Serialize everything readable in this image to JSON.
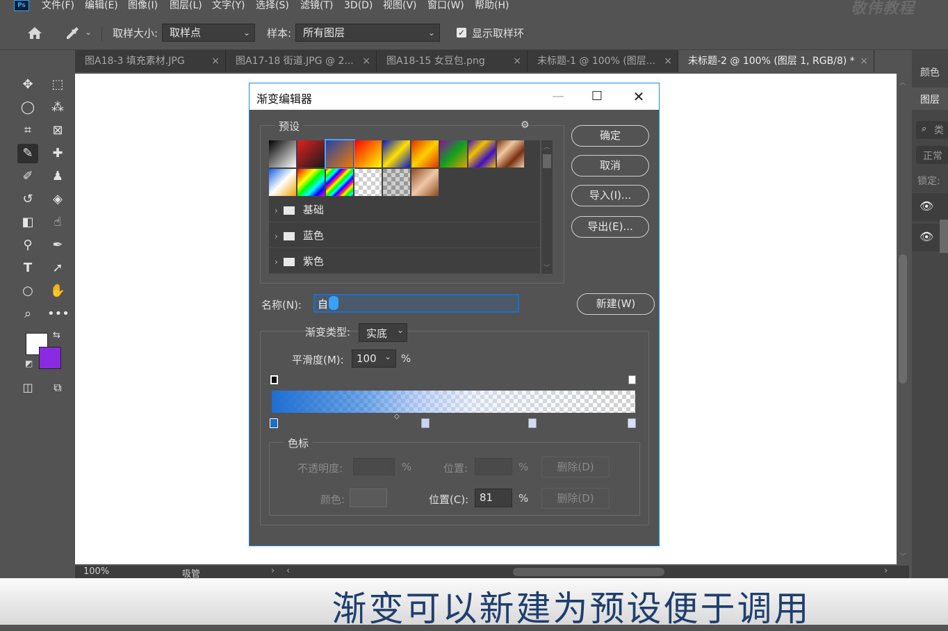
{
  "app": {
    "logo": "Ps",
    "watermark": "敬伟教程"
  },
  "menubar": [
    "文件(F)",
    "编辑(E)",
    "图像(I)",
    "图层(L)",
    "文字(Y)",
    "选择(S)",
    "滤镜(T)",
    "3D(D)",
    "视图(V)",
    "窗口(W)",
    "帮助(H)"
  ],
  "options": {
    "sample_size_label": "取样大小:",
    "sample_size_value": "取样点",
    "sample_label": "样本:",
    "sample_value": "所有图层",
    "show_ring_label": "显示取样环",
    "show_ring_checked": true
  },
  "tabs": [
    {
      "label": "图A18-3 填充素材.JPG",
      "active": false
    },
    {
      "label": "图A17-18 街道.JPG @ 2...",
      "active": false
    },
    {
      "label": "图A18-15 女豆包.png",
      "active": false
    },
    {
      "label": "未标题-1 @ 100% (图层...",
      "active": false
    },
    {
      "label": "未标题-2 @ 100% (图层 1, RGB/8) *",
      "active": true
    }
  ],
  "colors": {
    "foreground": "#ffffff",
    "background": "#8a2be2",
    "accent": "#1e88e5"
  },
  "status": {
    "zoom": "100%",
    "tool": "吸管"
  },
  "right_panel": {
    "color": "颜色",
    "layers": "图层",
    "kind": "类",
    "blend": "正常",
    "lock": "锁定:"
  },
  "subtitle": "渐变可以新建为预设便于调用",
  "dialog": {
    "title": "渐变编辑器",
    "presets_label": "预设",
    "folders": [
      "基础",
      "蓝色",
      "紫色"
    ],
    "buttons": {
      "ok": "确定",
      "cancel": "取消",
      "import": "导入(I)...",
      "export": "导出(E)...",
      "new": "新建(W)"
    },
    "name_label": "名称(N):",
    "name_value": "自",
    "gradient_type_label": "渐变类型:",
    "gradient_type_value": "实底",
    "smoothness_label": "平滑度(M):",
    "smoothness_value": "100",
    "percent": "%",
    "stops_label": "色标",
    "opacity_label": "不透明度:",
    "location_label": "位置:",
    "delete_label": "删除(D)",
    "color_label": "颜色:",
    "location_c_label": "位置(C):",
    "location_c_value": "81"
  }
}
